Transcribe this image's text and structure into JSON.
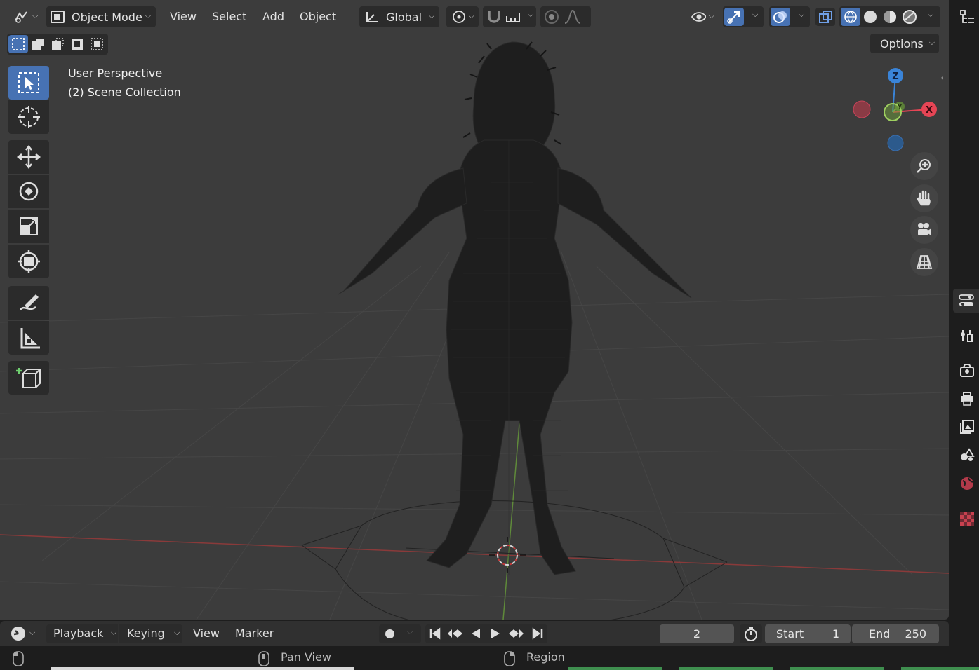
{
  "header": {
    "mode_label": "Object Mode",
    "menus": [
      "View",
      "Select",
      "Add",
      "Object"
    ],
    "orientation_label": "Global",
    "options_label": "Options"
  },
  "viewport": {
    "view_name": "User Perspective",
    "collection": "(2) Scene Collection"
  },
  "gizmo": {
    "z_label": "Z",
    "x_label": "X",
    "y_label": "Y"
  },
  "tools": [
    "select-box",
    "cursor",
    "move",
    "rotate",
    "scale",
    "transform",
    "annotate",
    "measure",
    "add-cube"
  ],
  "timeline": {
    "menus": [
      "Playback",
      "Keying",
      "View",
      "Marker"
    ],
    "current_frame": "2",
    "start_label": "Start",
    "start_value": "1",
    "end_label": "End",
    "end_value": "250"
  },
  "status": {
    "pan_label": "Pan View",
    "region_label": "Region"
  },
  "colors": {
    "accent": "#4772b3",
    "viewport_bg": "#3c3c3c",
    "axis_x": "#e64555",
    "axis_y": "#7fb34e",
    "axis_z": "#3a84d8"
  }
}
